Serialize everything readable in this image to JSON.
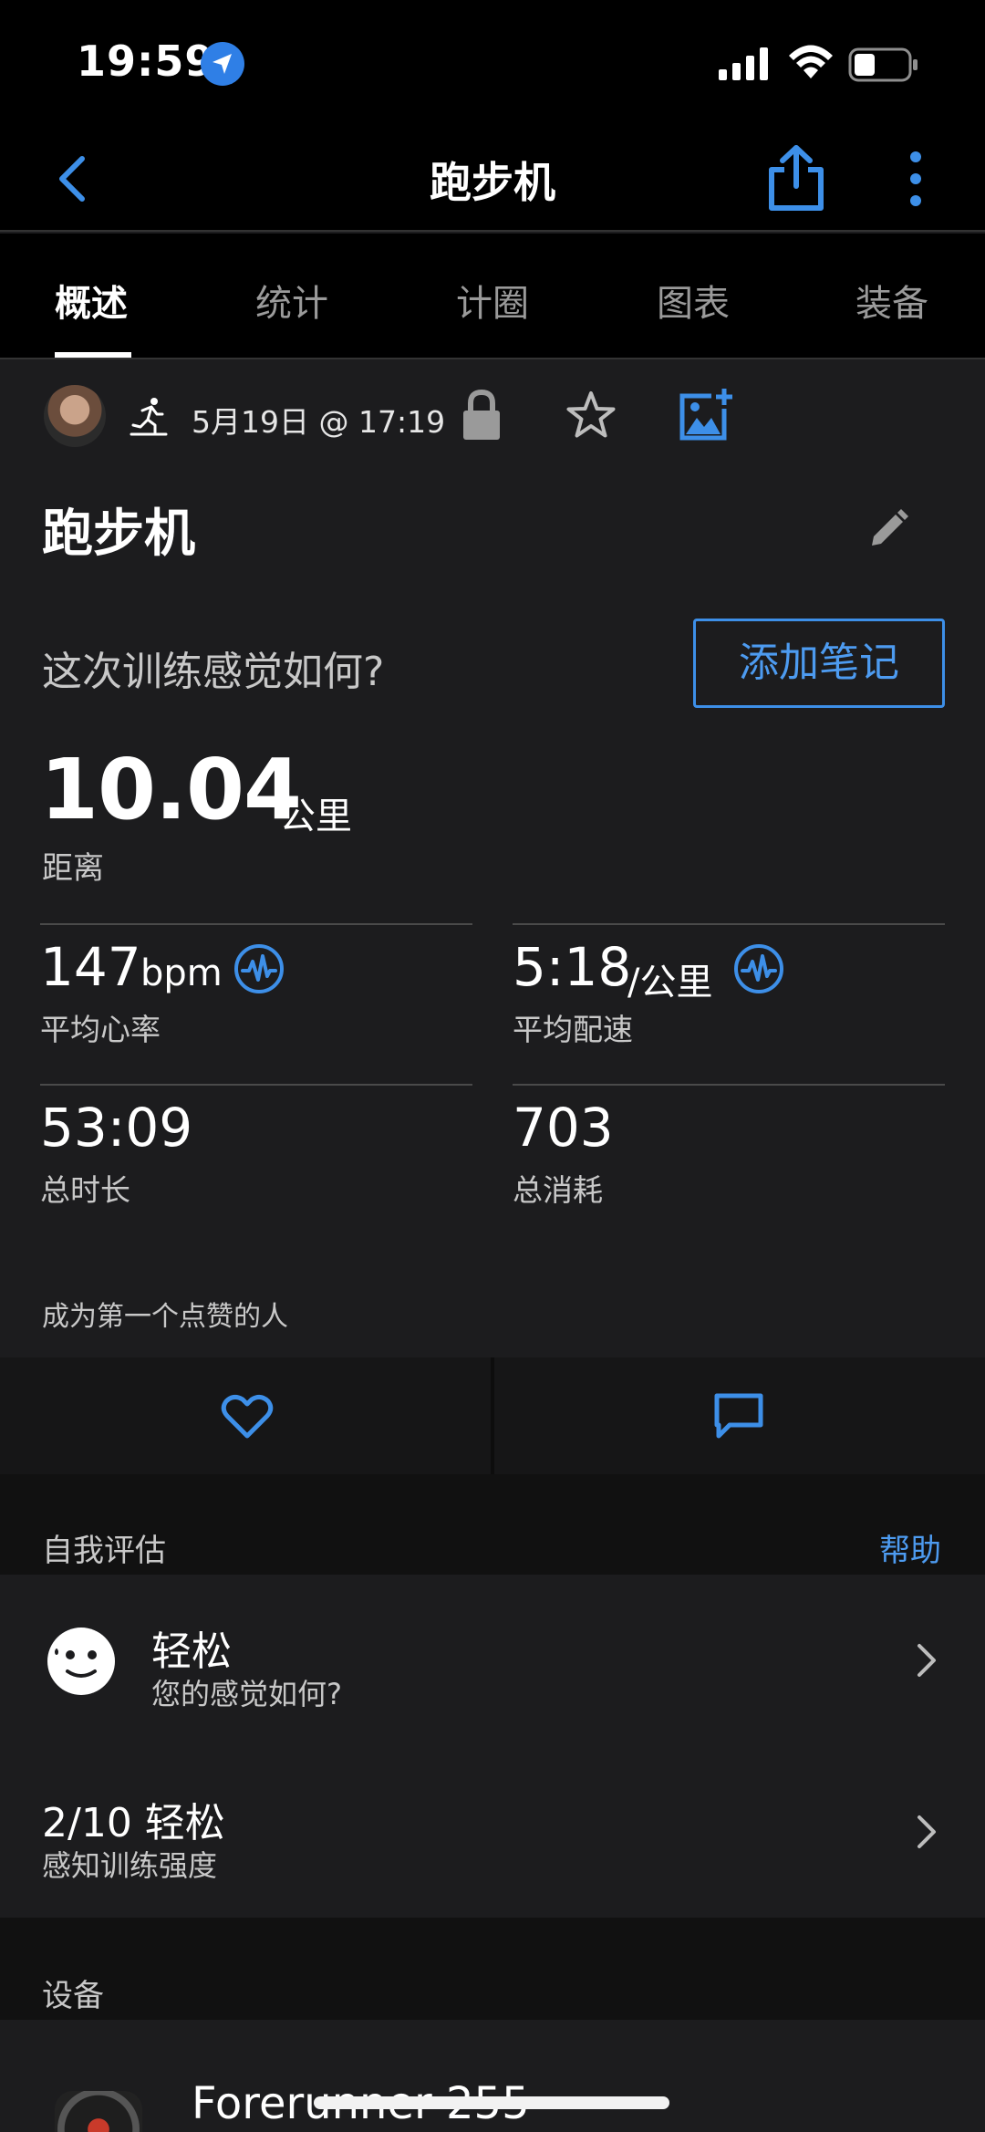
{
  "status_bar": {
    "time": "19:59",
    "icons": [
      "location-icon",
      "signal-icon",
      "wifi-icon",
      "battery-icon"
    ]
  },
  "nav": {
    "title": "跑步机",
    "back_icon": "chevron-left-icon",
    "share_icon": "share-icon",
    "more_icon": "more-vertical-icon"
  },
  "tabs": [
    {
      "label": "概述",
      "active": true
    },
    {
      "label": "统计"
    },
    {
      "label": "计圈"
    },
    {
      "label": "图表"
    },
    {
      "label": "装备"
    }
  ],
  "activity": {
    "date": "5月19日 @ 17:19",
    "title": "跑步机",
    "feel_question": "这次训练感觉如何?",
    "add_note_label": "添加笔记"
  },
  "distance": {
    "value": "10.04",
    "unit": "公里",
    "label": "距离"
  },
  "stats": {
    "heart_rate": {
      "value": "147",
      "unit": "bpm",
      "label": "平均心率"
    },
    "pace": {
      "value": "5:18",
      "unit": "/公里",
      "label": "平均配速"
    },
    "duration": {
      "value": "53:09",
      "label": "总时长"
    },
    "calories": {
      "value": "703",
      "label": "总消耗"
    }
  },
  "kudos_text": "成为第一个点赞的人",
  "self_eval": {
    "header": "自我评估",
    "help_label": "帮助",
    "feeling": {
      "title": "轻松",
      "subtitle": "您的感觉如何?"
    },
    "effort": {
      "title": "2/10 轻松",
      "subtitle": "感知训练强度"
    }
  },
  "device": {
    "header": "设备",
    "name": "Forerunner 255"
  },
  "colors": {
    "accent": "#4d9bf0",
    "background": "#1c1c1e",
    "section": "#111111"
  }
}
